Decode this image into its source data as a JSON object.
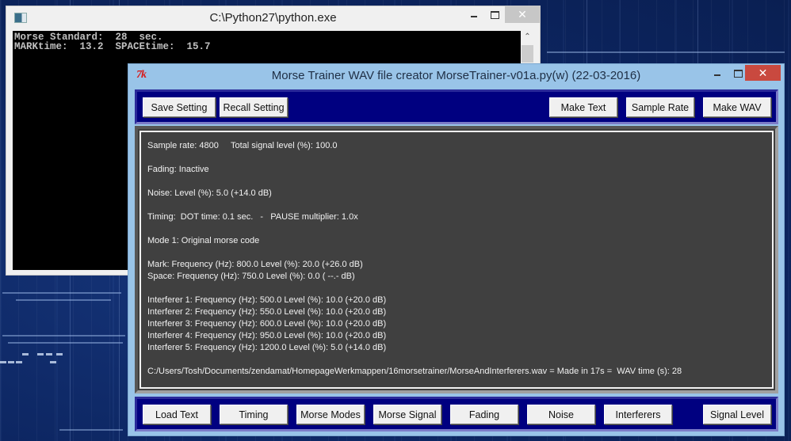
{
  "console": {
    "title": "C:\\Python27\\python.exe",
    "lines": [
      "Morse Standard:  28  sec.",
      "MARKtime:  13.2  SPACEtime:  15.7"
    ],
    "controls": {
      "minimize": "minimize-icon",
      "maximize": "maximize-icon",
      "close": "✕"
    }
  },
  "main_window": {
    "icon_text": "7k",
    "title": "Morse Trainer WAV file creator MorseTrainer-v01a.py(w) (22-03-2016)",
    "controls": {
      "close": "✕"
    },
    "colors": {
      "toolbar_bg": "#000080",
      "frame_bg": "#99c4e8",
      "text_bg": "#404040",
      "close_red": "#c9493f"
    },
    "top_toolbar": {
      "left_buttons": [
        "Save Setting",
        "Recall Setting"
      ],
      "right_buttons": [
        "Make Text",
        "Sample Rate",
        "Make WAV"
      ]
    },
    "output": {
      "sample_line": "Sample rate: 4800     Total signal level (%): 100.0",
      "fading": "Fading: Inactive",
      "noise": "Noise: Level (%): 5.0 (+14.0 dB)",
      "timing": "Timing:  DOT time: 0.1 sec.   -   PAUSE multiplier: 1.0x",
      "mode": "Mode 1: Original morse code",
      "mark": "Mark: Frequency (Hz): 800.0 Level (%): 20.0 (+26.0 dB)",
      "space": "Space: Frequency (Hz): 750.0 Level (%): 0.0 ( --.- dB)",
      "interferers": [
        "Interferer 1: Frequency (Hz): 500.0 Level (%): 10.0 (+20.0 dB)",
        "Interferer 2: Frequency (Hz): 550.0 Level (%): 10.0 (+20.0 dB)",
        "Interferer 3: Frequency (Hz): 600.0 Level (%): 10.0 (+20.0 dB)",
        "Interferer 4: Frequency (Hz): 950.0 Level (%): 10.0 (+20.0 dB)",
        "Interferer 5: Frequency (Hz): 1200.0 Level (%): 5.0 (+14.0 dB)"
      ],
      "result": "C:/Users/Tosh/Documents/zendamat/HomepageWerkmappen/16morsetrainer/MorseAndInterferers.wav = Made in 17s =  WAV time (s): 28"
    },
    "bottom_toolbar": {
      "buttons": [
        "Load Text",
        "Timing",
        "Morse Modes",
        "Morse Signal",
        "Fading",
        "Noise",
        "Interferers",
        "Signal Level"
      ]
    }
  }
}
